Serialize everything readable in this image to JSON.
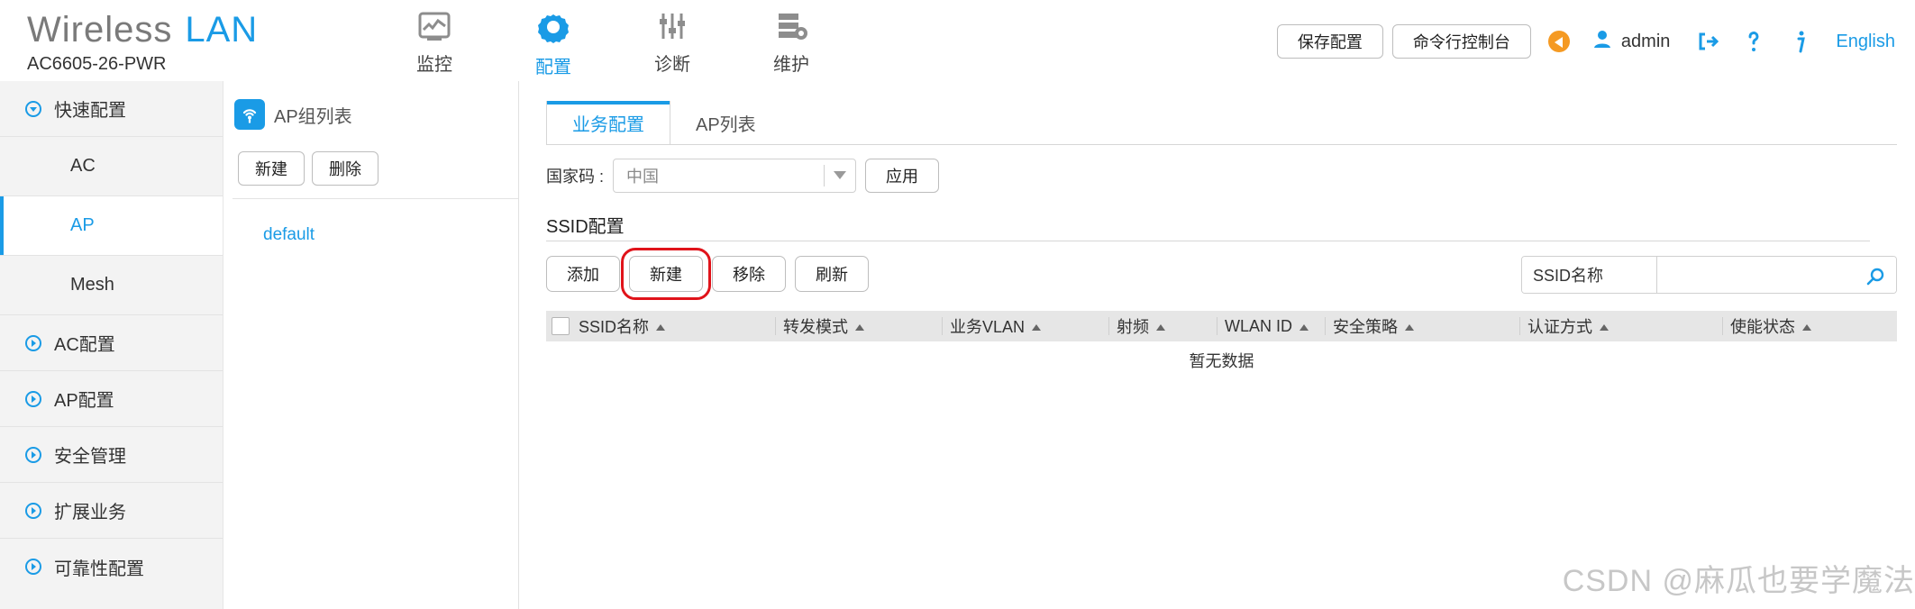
{
  "colors": {
    "accent": "#1a9be6",
    "red_highlight": "#e0131a"
  },
  "header": {
    "brand_left": "Wireless",
    "brand_right": "LAN",
    "model": "AC6605-26-PWR",
    "nav": [
      {
        "label": "监控",
        "icon": "monitor-icon"
      },
      {
        "label": "配置",
        "icon": "gear-icon"
      },
      {
        "label": "诊断",
        "icon": "sliders-icon"
      },
      {
        "label": "维护",
        "icon": "server-settings-icon"
      }
    ],
    "buttons": {
      "save": "保存配置",
      "console": "命令行控制台"
    },
    "user": "admin",
    "language": "English"
  },
  "sidebar": {
    "quick_config": "快速配置",
    "sub": [
      "AC",
      "AP",
      "Mesh"
    ],
    "sections": [
      "AC配置",
      "AP配置",
      "安全管理",
      "扩展业务",
      "可靠性配置"
    ]
  },
  "ap_group_panel": {
    "title": "AP组列表",
    "buttons": {
      "new": "新建",
      "delete": "删除"
    },
    "items": [
      "default"
    ]
  },
  "main": {
    "tabs": [
      "业务配置",
      "AP列表"
    ],
    "country_label": "国家码 :",
    "country_value": "中国",
    "apply": "应用",
    "ssid_section": "SSID配置",
    "ssid_buttons": {
      "add": "添加",
      "new": "新建",
      "remove": "移除",
      "refresh": "刷新"
    },
    "search_label": "SSID名称",
    "search_value": "",
    "table": {
      "headers": [
        "SSID名称",
        "转发模式",
        "业务VLAN",
        "射频",
        "WLAN ID",
        "安全策略",
        "认证方式",
        "使能状态"
      ],
      "empty": "暂无数据"
    }
  },
  "watermark": "CSDN @麻瓜也要学魔法"
}
